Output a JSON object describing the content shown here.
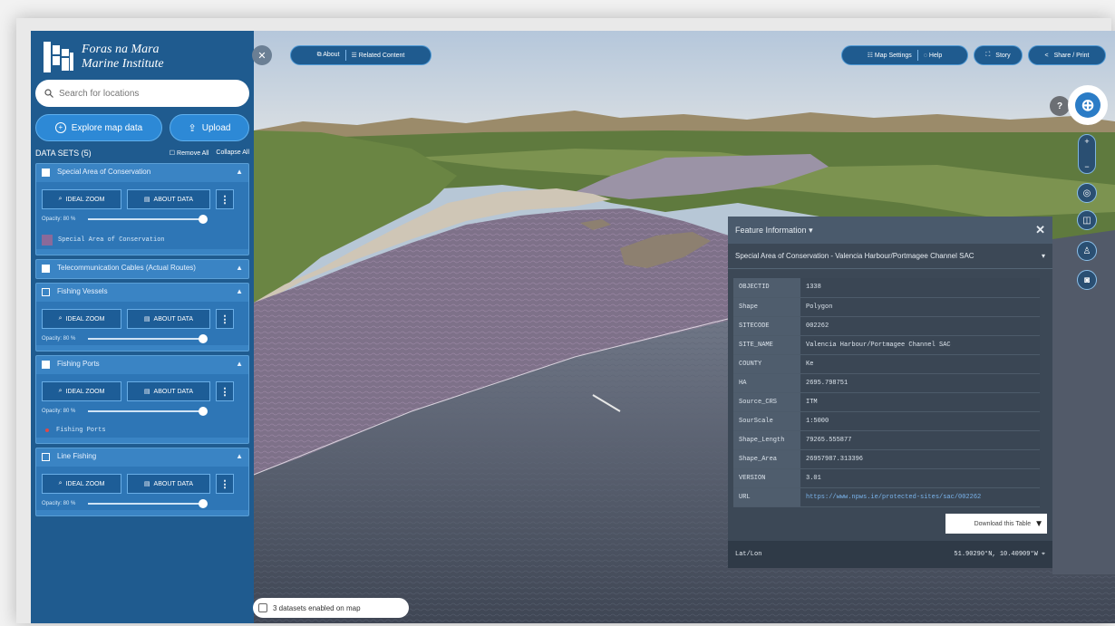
{
  "sidebar": {
    "logo": {
      "line1": "Foras na Mara",
      "line2": "Marine Institute"
    },
    "search": {
      "placeholder": "Search for locations"
    },
    "explore_label": "Explore map data",
    "upload_label": "Upload",
    "datasets_title": "DATA SETS (5)",
    "remove_all": "Remove All",
    "collapse_all": "Collapse All",
    "opacity_label": "Opacity: 80 %",
    "ideal_zoom": "IDEAL ZOOM",
    "about_data": "ABOUT DATA",
    "more": "⋮",
    "datasets": [
      {
        "title": "Special Area of Conservation",
        "checked": true,
        "expanded": true,
        "legend": "Special Area of Conservation"
      },
      {
        "title": "Telecommunication Cables (Actual Routes)",
        "checked": true,
        "expanded": false
      },
      {
        "title": "Fishing Vessels",
        "checked": false,
        "expanded": true
      },
      {
        "title": "Fishing Ports",
        "checked": true,
        "expanded": true,
        "legend": "Fishing Ports"
      },
      {
        "title": "Line Fishing",
        "checked": false,
        "expanded": true
      }
    ]
  },
  "toolbar": {
    "about": "About",
    "related": "Related Content",
    "map_settings": "Map Settings",
    "help": "Help",
    "story": "Story",
    "share_print": "Share / Print"
  },
  "feature_info": {
    "title": "Feature Information",
    "selected": "Special Area of Conservation - Valencia Harbour/Portmagee Channel SAC",
    "rows": [
      {
        "key": "OBJECTID",
        "value": "1338"
      },
      {
        "key": "Shape",
        "value": "Polygon"
      },
      {
        "key": "SITECODE",
        "value": "002262"
      },
      {
        "key": "SITE_NAME",
        "value": "Valencia Harbour/Portmagee Channel SAC"
      },
      {
        "key": "COUNTY",
        "value": "Ke"
      },
      {
        "key": "HA",
        "value": "2695.798751"
      },
      {
        "key": "Source_CRS",
        "value": "ITM"
      },
      {
        "key": "SourScale",
        "value": "1:5000"
      },
      {
        "key": "Shape_Length",
        "value": "79265.555877"
      },
      {
        "key": "Shape_Area",
        "value": "26957987.313396"
      },
      {
        "key": "VERSION",
        "value": "3.01"
      },
      {
        "key": "URL",
        "value": "https://www.npws.ie/protected-sites/sac/002262"
      }
    ],
    "download": "Download this Table",
    "latlon_label": "Lat/Lon",
    "latlon_value": "51.90290°N, 10.40909°W"
  },
  "status_chip": "3 datasets enabled on map",
  "map_controls": {
    "help": "?",
    "zoom_in": "+",
    "zoom_out": "−"
  },
  "colors": {
    "sidebar": "#1f5b8f",
    "card": "#3a84c4",
    "accent": "#2d89d6",
    "panel": "#3c4856",
    "sac_fill": "#8a6a9a"
  }
}
